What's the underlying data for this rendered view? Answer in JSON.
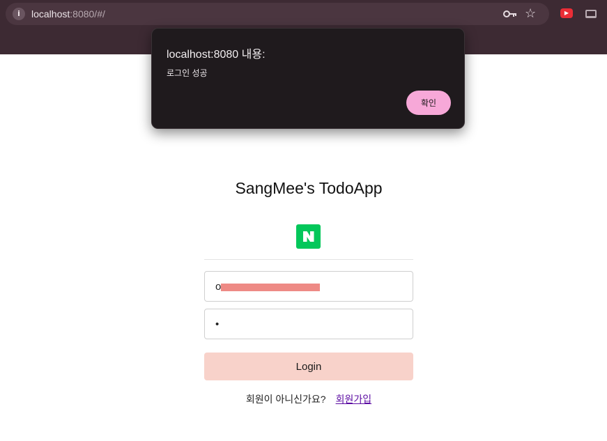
{
  "browser": {
    "url_host": "localhost",
    "url_rest": ":8080/#/",
    "icons": [
      "info-icon",
      "key-icon",
      "star-icon",
      "extension-icon",
      "laptop-icon"
    ],
    "extension_icon_color": "#ea2d36"
  },
  "dialog": {
    "title": "localhost:8080 내용:",
    "message": "로그인 성공",
    "ok_label": "확인",
    "ok_color": "#f7a8d8"
  },
  "page": {
    "title": "SangMee's TodoApp",
    "naver_label": "N",
    "naver_color": "#03c75a",
    "email_value": "o",
    "password_value": "•",
    "login_label": "Login",
    "login_color": "#f8d2ca",
    "signup_prompt": "회원이 아니신가요?",
    "signup_link": "회원가입"
  }
}
